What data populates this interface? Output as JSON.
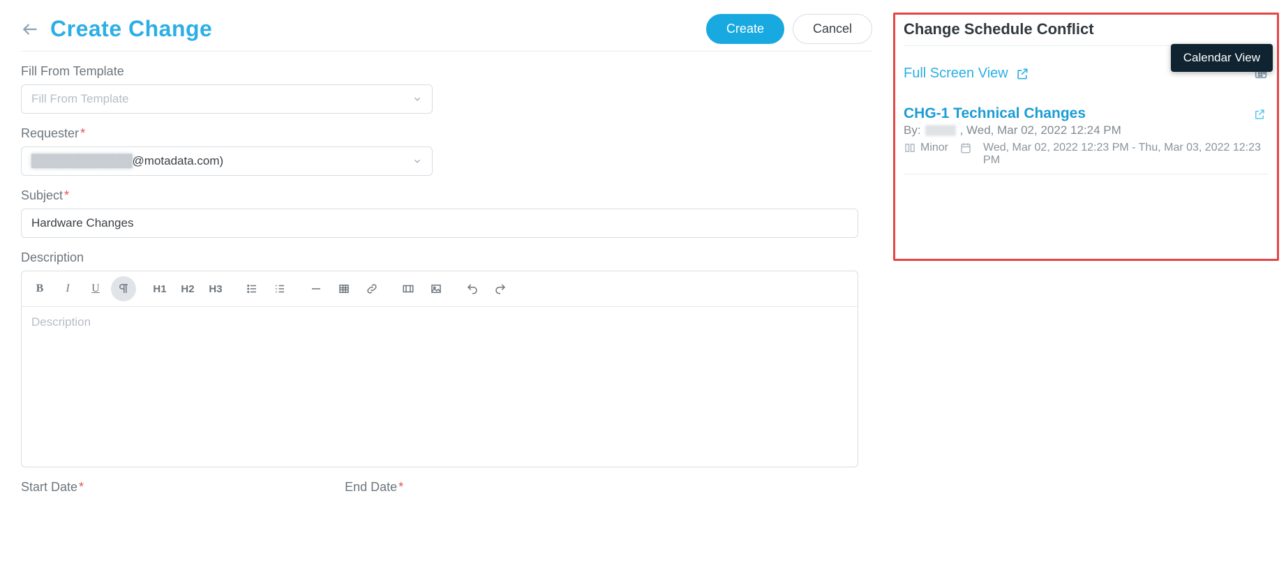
{
  "header": {
    "title": "Create Change",
    "create_label": "Create",
    "cancel_label": "Cancel"
  },
  "form": {
    "template_label": "Fill From Template",
    "template_placeholder": "Fill From Template",
    "requester_label": "Requester",
    "requester_value": "@motadata.com)",
    "subject_label": "Subject",
    "subject_value": "Hardware Changes",
    "description_label": "Description",
    "description_placeholder": "Description",
    "toolbar": {
      "bold": "B",
      "italic": "I",
      "underline": "U",
      "h1": "H1",
      "h2": "H2",
      "h3": "H3"
    },
    "start_date_label": "Start Date",
    "end_date_label": "End Date"
  },
  "side": {
    "title": "Change Schedule Conflict",
    "calendar_view_label": "Calendar View",
    "full_view_label": "Full Screen View",
    "change": {
      "title": "CHG-1 Technical Changes",
      "by_prefix": "By:",
      "by_date": ", Wed, Mar 02, 2022 12:24 PM",
      "priority": "Minor",
      "range": "Wed, Mar 02, 2022 12:23 PM - Thu, Mar 03, 2022 12:23 PM"
    }
  }
}
